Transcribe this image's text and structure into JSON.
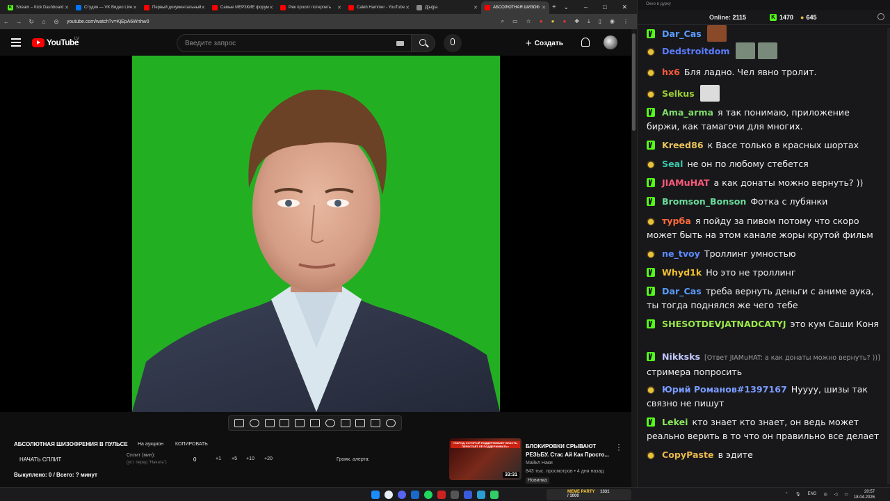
{
  "browser": {
    "tabs": [
      {
        "title": "Stream – Kick Dashboard",
        "fav_color": "#53fc18",
        "fav": "K"
      },
      {
        "title": "Студия — VK Видео Live",
        "fav_color": "#0077ff",
        "fav": ""
      },
      {
        "title": "Первый документальный",
        "fav_color": "#ff0000",
        "fav": ""
      },
      {
        "title": "Самые МЕРЗКИЕ форум",
        "fav_color": "#ff0000",
        "fav": ""
      },
      {
        "title": "Ржк просит потерпеть",
        "fav_color": "#ff0000",
        "fav": ""
      },
      {
        "title": "Caleb Hammer - YouTube",
        "fav_color": "#ff0000",
        "fav": ""
      },
      {
        "title": "Д[ы]ра",
        "fav_color": "#888888",
        "fav": ""
      },
      {
        "title": "АБСОЛЮТНАЯ ШИЗОФ",
        "fav_color": "#ff0000",
        "fav": ""
      }
    ],
    "url": "youtube.com/watch?v=KjEpA6Wnhw0"
  },
  "youtube": {
    "logo": "YouTube",
    "region": "LV",
    "search_placeholder": "Введите запрос",
    "create_label": "Создать"
  },
  "split": {
    "title": "АБСОЛЮТНАЯ ШИЗОФРЕНИЯ В ПУЛЬСЕ",
    "auction": "На аукцион",
    "copy": "КОПИРОВАТЬ",
    "start": "НАЧАТЬ СПЛИТ",
    "min_label": "Сплит (мин):",
    "min_note": "(уст. перед \"Начать\")",
    "value": "0",
    "increments": [
      "+1",
      "+5",
      "+10",
      "+20"
    ],
    "alert": "Громк. алерта:",
    "bought": "Выкуплено: 0 / Всего: ? минут"
  },
  "recommendation": {
    "banner": "«НАРОД, КОТОРЫЙ ПОДДЕРЖИВАЕТ ВЛАСТЬ, ПЕРЕСТАЁТ ЕЁ ПОДДЕРЖИВАТЬ»",
    "duration": "33:31",
    "title": "БЛОКИРОВКИ СРЫВАЮТ РЕЗЬБУ. Стас Ай Как Просто...",
    "channel": "Майкл Наки",
    "meta": "843 тыс. просмотров • 4 дня назад",
    "badge": "Новинка"
  },
  "chat": {
    "window_title": "Окно в дурку",
    "online_label": "Online:",
    "online_value": "2115",
    "kick_count": "1470",
    "follow_count": "645",
    "messages": [
      {
        "badge": "k",
        "user": "Dar_Cas",
        "color": "#5b9bff",
        "text": "",
        "emote": "#8a4a2a"
      },
      {
        "badge": "b",
        "user": "Dedstroitdom",
        "color": "#5b7cff",
        "text": "",
        "emote": "#7a8a7a"
      },
      {
        "badge": "b",
        "user": "hx6",
        "color": "#ff5a3c",
        "text": "Бля ладно. Чел явно тролит."
      },
      {
        "badge": "b",
        "user": "Selkus",
        "color": "#9acd32",
        "text": "",
        "emote": "#dcdcdc"
      },
      {
        "badge": "k",
        "user": "Ama_arma",
        "color": "#7fdc6a",
        "text": "я так понимаю, приложение биржи, как тамагочи для многих."
      },
      {
        "badge": "k",
        "user": "Kreed86",
        "color": "#e8c25a",
        "text": "к Васе только в красных шортах"
      },
      {
        "badge": "b",
        "user": "Seal",
        "color": "#3cc8a8",
        "text": "не он по любому стебется"
      },
      {
        "badge": "k",
        "user": "JIAMuHAT",
        "color": "#ff5a7a",
        "text": "а как донаты можно вернуть? ))"
      },
      {
        "badge": "k",
        "user": "Bromson_Bonson",
        "color": "#6adc9a",
        "text": "Фотка с лубянки"
      },
      {
        "badge": "b",
        "user": "турба",
        "color": "#ff6a3c",
        "text": "я пойду за пивом потому что скоро может быть на этом канале жоры крутой фильм"
      },
      {
        "badge": "b",
        "user": "ne_tvoy",
        "color": "#5b8cff",
        "text": "Троллинг умностью"
      },
      {
        "badge": "k",
        "user": "Whyd1k",
        "color": "#f2c12e",
        "text": "Но это не троллинг"
      },
      {
        "badge": "k",
        "user": "Dar_Cas",
        "color": "#5b9bff",
        "text": "треба вернуть деньги с аниме аука, ты тогда поднялся же чего тебе"
      },
      {
        "badge": "k",
        "user": "SHESOTDEVJATNADCATYJ",
        "color": "#9be84a",
        "text": "это кум Саши Коня"
      },
      {
        "badge": "k",
        "user": "Nikksks",
        "color": "#c4c9ff",
        "reply": "[Ответ JIAMuHAT: а как донаты можно вернуть? ))]",
        "text": "стримера попросить"
      },
      {
        "badge": "b",
        "user": "Юрий Романов#1397167",
        "color": "#7a9cff",
        "text": "Нуууу, шизы так связно не пишут"
      },
      {
        "badge": "k",
        "user": "Lekei",
        "color": "#8ae85a",
        "text": "кто знает кто знает, он ведь может реально верить в то что он правильно все делает"
      },
      {
        "badge": "b",
        "user": "CopyPaste",
        "color": "#e8b84a",
        "text": "в эдите"
      }
    ]
  },
  "taskbar": {
    "meme": "MEME PARTY",
    "meme_sub": "1331 / 1000",
    "lang": "ENG",
    "time": "20:57",
    "date": "18.04.2026"
  }
}
